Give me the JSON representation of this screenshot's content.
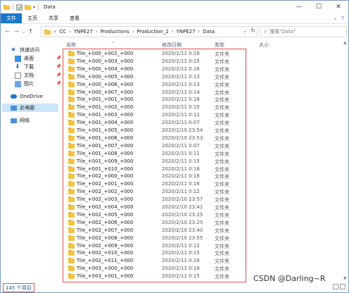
{
  "window": {
    "title": "Data"
  },
  "ribbon": {
    "tabs": [
      "文件",
      "主页",
      "共享",
      "查看"
    ]
  },
  "address": {
    "crumbs": [
      "CC",
      "YNPE27",
      "Productions",
      "Production_2",
      "YNPE27",
      "Data"
    ],
    "search_placeholder": "搜索\"Data\""
  },
  "sidebar": {
    "items": [
      {
        "label": "快速访问"
      },
      {
        "label": "桌面"
      },
      {
        "label": "下载"
      },
      {
        "label": "文档"
      },
      {
        "label": "图片"
      },
      {
        "label": "OneDrive"
      },
      {
        "label": "此电脑"
      },
      {
        "label": "网络"
      }
    ]
  },
  "list": {
    "headers": {
      "name": "名称",
      "date": "修改日期",
      "type": "类型",
      "size": "大小"
    },
    "rows": [
      {
        "name": "Tile_+000_+002_+000",
        "date": "2020/2/11 0:16",
        "type": "文件夹"
      },
      {
        "name": "Tile_+000_+003_+000",
        "date": "2020/2/11 0:15",
        "type": "文件夹"
      },
      {
        "name": "Tile_+000_+004_+000",
        "date": "2020/2/11 0:16",
        "type": "文件夹"
      },
      {
        "name": "Tile_+000_+005_+000",
        "date": "2020/2/11 0:13",
        "type": "文件夹"
      },
      {
        "name": "Tile_+000_+006_+000",
        "date": "2020/2/11 0:13",
        "type": "文件夹"
      },
      {
        "name": "Tile_+000_+007_+000",
        "date": "2020/2/11 0:14",
        "type": "文件夹"
      },
      {
        "name": "Tile_+001_+001_+000",
        "date": "2020/2/11 0:16",
        "type": "文件夹"
      },
      {
        "name": "Tile_+001_+002_+000",
        "date": "2020/2/11 0:15",
        "type": "文件夹"
      },
      {
        "name": "Tile_+001_+003_+000",
        "date": "2020/2/11 0:12",
        "type": "文件夹"
      },
      {
        "name": "Tile_+001_+004_+000",
        "date": "2020/2/11 0:07",
        "type": "文件夹"
      },
      {
        "name": "Tile_+001_+005_+000",
        "date": "2020/2/10 23:54",
        "type": "文件夹"
      },
      {
        "name": "Tile_+001_+006_+000",
        "date": "2020/2/10 23:53",
        "type": "文件夹"
      },
      {
        "name": "Tile_+001_+007_+000",
        "date": "2020/2/11 0:07",
        "type": "文件夹"
      },
      {
        "name": "Tile_+001_+008_+000",
        "date": "2020/2/11 0:11",
        "type": "文件夹"
      },
      {
        "name": "Tile_+001_+009_+000",
        "date": "2020/2/11 0:15",
        "type": "文件夹"
      },
      {
        "name": "Tile_+001_+010_+000",
        "date": "2020/2/11 0:16",
        "type": "文件夹"
      },
      {
        "name": "Tile_+002_+000_+000",
        "date": "2020/2/11 0:16",
        "type": "文件夹"
      },
      {
        "name": "Tile_+002_+001_+000",
        "date": "2020/2/11 0:16",
        "type": "文件夹"
      },
      {
        "name": "Tile_+002_+002_+000",
        "date": "2020/2/11 0:12",
        "type": "文件夹"
      },
      {
        "name": "Tile_+002_+003_+000",
        "date": "2020/2/10 23:57",
        "type": "文件夹"
      },
      {
        "name": "Tile_+002_+004_+000",
        "date": "2020/2/10 23:41",
        "type": "文件夹"
      },
      {
        "name": "Tile_+002_+005_+000",
        "date": "2020/2/10 23:25",
        "type": "文件夹"
      },
      {
        "name": "Tile_+002_+006_+000",
        "date": "2020/2/10 23:25",
        "type": "文件夹"
      },
      {
        "name": "Tile_+002_+007_+000",
        "date": "2020/2/10 23:40",
        "type": "文件夹"
      },
      {
        "name": "Tile_+002_+008_+000",
        "date": "2020/2/10 23:55",
        "type": "文件夹"
      },
      {
        "name": "Tile_+002_+009_+000",
        "date": "2020/2/11 0:12",
        "type": "文件夹"
      },
      {
        "name": "Tile_+002_+010_+000",
        "date": "2020/2/11 0:15",
        "type": "文件夹"
      },
      {
        "name": "Tile_+002_+011_+000",
        "date": "2020/2/11 0:16",
        "type": "文件夹"
      },
      {
        "name": "Tile_+003_+000_+000",
        "date": "2020/2/11 0:16",
        "type": "文件夹"
      },
      {
        "name": "Tile_+003_+001_+000",
        "date": "2020/2/11 0:15",
        "type": "文件夹"
      }
    ]
  },
  "status": {
    "item_count": "145 个项目"
  },
  "watermark": "CSDN @Darling~R"
}
